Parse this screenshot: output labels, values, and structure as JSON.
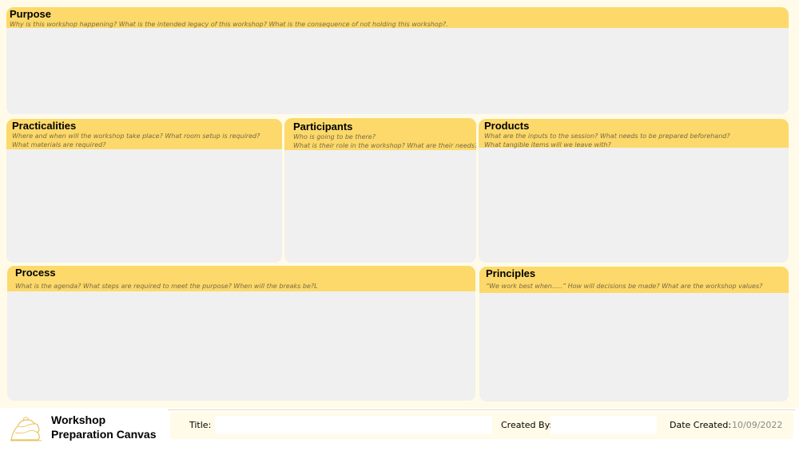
{
  "panels": {
    "purpose": {
      "title": "Purpose",
      "prompt_lines": [
        "Why is this workshop happening? What is the intended legacy of this workshop? What is the consequence of not holding this workshop?."
      ]
    },
    "practicalities": {
      "title": "Practicalities",
      "prompt_lines": [
        "Where and when will the workshop take place? What room setup is required?",
        "What materials are required?"
      ]
    },
    "participants": {
      "title": "Participants",
      "prompt_lines": [
        "Who is going to be there?",
        "What is their role in the workshop? What are their needs?"
      ]
    },
    "products": {
      "title": "Products",
      "prompt_lines": [
        "What are the inputs to the session? What needs to be prepared beforehand?",
        "What tangible items will we leave with?"
      ]
    },
    "process": {
      "title": "Process",
      "prompt_lines": [
        "What is the agenda? What steps are required to meet the purpose? When will the breaks be?L"
      ]
    },
    "principles": {
      "title": "Principles",
      "prompt_lines": [
        "“We work best when…..” How will decisions be made? What are the workshop values?"
      ]
    }
  },
  "footer": {
    "canvas_name_line1": "Workshop",
    "canvas_name_line2": "Preparation Canvas",
    "title_label": "Title:",
    "title_value": "",
    "created_by_label": "Created By:",
    "created_by_value": "",
    "date_label": "Date Created:",
    "date_value": "10/09/2022"
  },
  "colors": {
    "header": "#fcd96a",
    "panel_body": "#f0f0f0",
    "canvas_background": "#fffbe8",
    "logo_stroke": "#e8c35c"
  },
  "icons": {
    "logo": "brand-logo-icon"
  }
}
